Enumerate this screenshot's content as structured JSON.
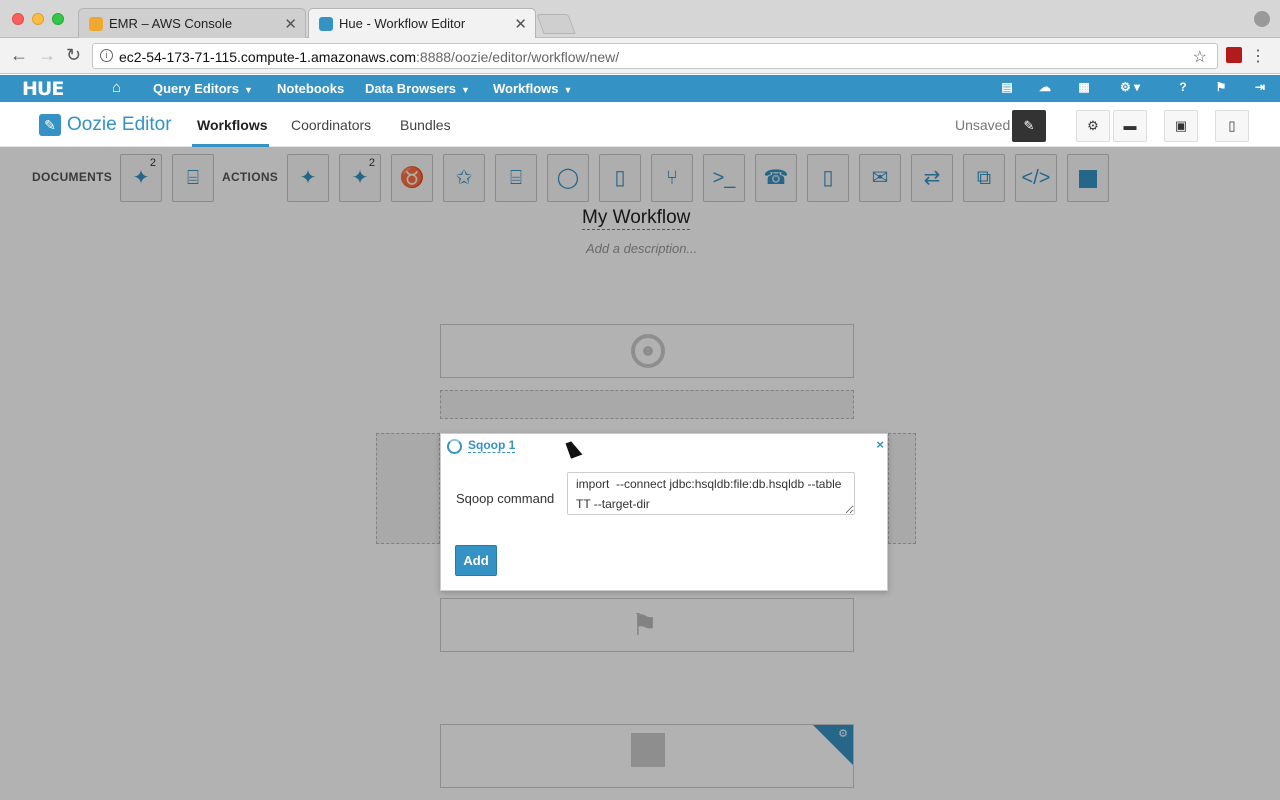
{
  "browser": {
    "tabs": [
      {
        "title": "EMR – AWS Console",
        "favicon_color": "#f0a830"
      },
      {
        "title": "Hue - Workflow Editor",
        "favicon_color": "#3592c4"
      }
    ],
    "url_host": "ec2-54-173-71-115.compute-1.amazonaws.com",
    "url_rest": ":8888/oozie/editor/workflow/new/"
  },
  "hue_nav": {
    "logo": "HUE",
    "items": [
      "Query Editors",
      "Notebooks",
      "Data Browsers",
      "Workflows"
    ],
    "accent_color": "#3592c4"
  },
  "subnav": {
    "app_title": "Oozie Editor",
    "tabs": [
      "Workflows",
      "Coordinators",
      "Bundles"
    ],
    "status": "Unsaved"
  },
  "palette": {
    "documents_label": "DOCUMENTS",
    "actions_label": "ACTIONS",
    "documents_superscripts": [
      "2"
    ],
    "actions_superscripts": [
      "2"
    ]
  },
  "workflow": {
    "title": "My Workflow",
    "description_placeholder": "Add a description..."
  },
  "modal": {
    "title": "Sqoop 1",
    "close": "×",
    "field_label": "Sqoop command",
    "field_value": "import  --connect jdbc:hsqldb:file:db.hsqldb --table TT --target-dir",
    "add_label": "Add"
  }
}
